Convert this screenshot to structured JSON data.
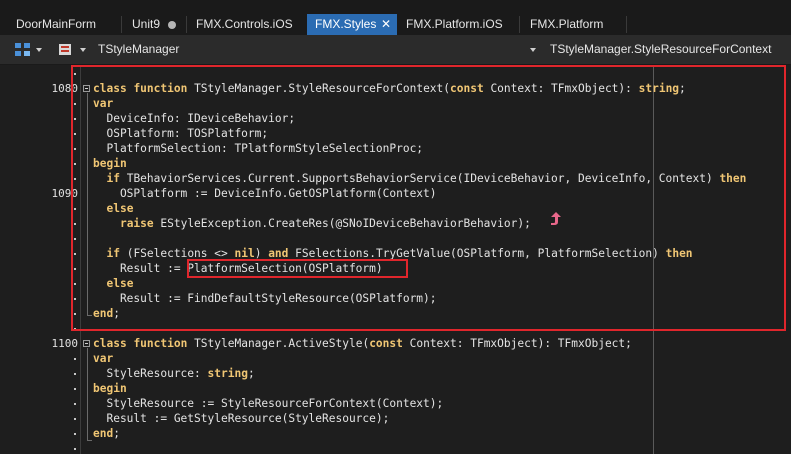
{
  "tabs": [
    {
      "label": "DoorMainForm",
      "active": false
    },
    {
      "label": "Unit9",
      "active": false,
      "modified": true
    },
    {
      "label": "FMX.Controls.iOS",
      "active": false
    },
    {
      "label": "FMX.Styles",
      "active": true,
      "close": "✕"
    },
    {
      "label": "FMX.Platform.iOS",
      "active": false
    },
    {
      "label": "FMX.Platform",
      "active": false
    }
  ],
  "toolbar": {
    "class_selector": "TStyleManager",
    "method_selector": "TStyleManager.StyleResourceForContext"
  },
  "line_numbers": {
    "n1080": "1080",
    "n1090": "1090",
    "n1100": "1100"
  },
  "code": {
    "l1": {
      "kw1": "class",
      "kw2": "function",
      "t1": " TStyleManager.StyleResourceForContext(",
      "kw3": "const",
      "t2": " Context: TFmxObject): ",
      "kw4": "string",
      "t3": ";"
    },
    "l2": {
      "kw1": "var"
    },
    "l3": {
      "t1": "  DeviceInfo: IDeviceBehavior;"
    },
    "l4": {
      "t1": "  OSPlatform: TOSPlatform;"
    },
    "l5": {
      "t1": "  PlatformSelection: TPlatformStyleSelectionProc;"
    },
    "l6": {
      "kw1": "begin"
    },
    "l7": {
      "kw1": "if",
      "t1": " TBehaviorServices.Current.SupportsBehaviorService(IDeviceBehavior, DeviceInfo, Context) ",
      "kw2": "then"
    },
    "l8": {
      "t1": "    OSPlatform := DeviceInfo.GetOSPlatform(Context)"
    },
    "l9": {
      "kw1": "else"
    },
    "l10": {
      "kw1": "raise",
      "t1": " EStyleException.CreateRes(@SNoIDeviceBehaviorBehavior);"
    },
    "l11": {
      "kw1": "if",
      "t1": " (FSelections <> ",
      "kw2": "nil",
      "t2": ") ",
      "kw3": "and",
      "t3": " FSelections.TryGetValue(OSPlatform, PlatformSelection) ",
      "kw4": "then"
    },
    "l12": {
      "t1": "    Result := ",
      "t2": "PlatformSelection(OSPlatform)"
    },
    "l13": {
      "kw1": "else"
    },
    "l14": {
      "t1": "    Result := FindDefaultStyleResource(OSPlatform);"
    },
    "l15": {
      "kw1": "end",
      "t1": ";"
    },
    "l16": {
      "kw1": "class",
      "kw2": "function",
      "t1": " TStyleManager.ActiveStyle(",
      "kw3": "const",
      "t2": " Context: TFmxObject): TFmxObject;"
    },
    "l17": {
      "kw1": "var"
    },
    "l18": {
      "t1": "  StyleResource: ",
      "kw1": "string",
      "t2": ";"
    },
    "l19": {
      "kw1": "begin"
    },
    "l20": {
      "t1": "  StyleResource := StyleResourceForContext(Context);"
    },
    "l21": {
      "t1": "  Result := GetStyleResource(StyleResource);"
    },
    "l22": {
      "kw1": "end",
      "t1": ";"
    }
  },
  "colors": {
    "highlight_box": "#e0262c",
    "active_tab": "#2b6cb3",
    "keyword": "#f0c674",
    "cursor_arrow": "#e8678a"
  }
}
